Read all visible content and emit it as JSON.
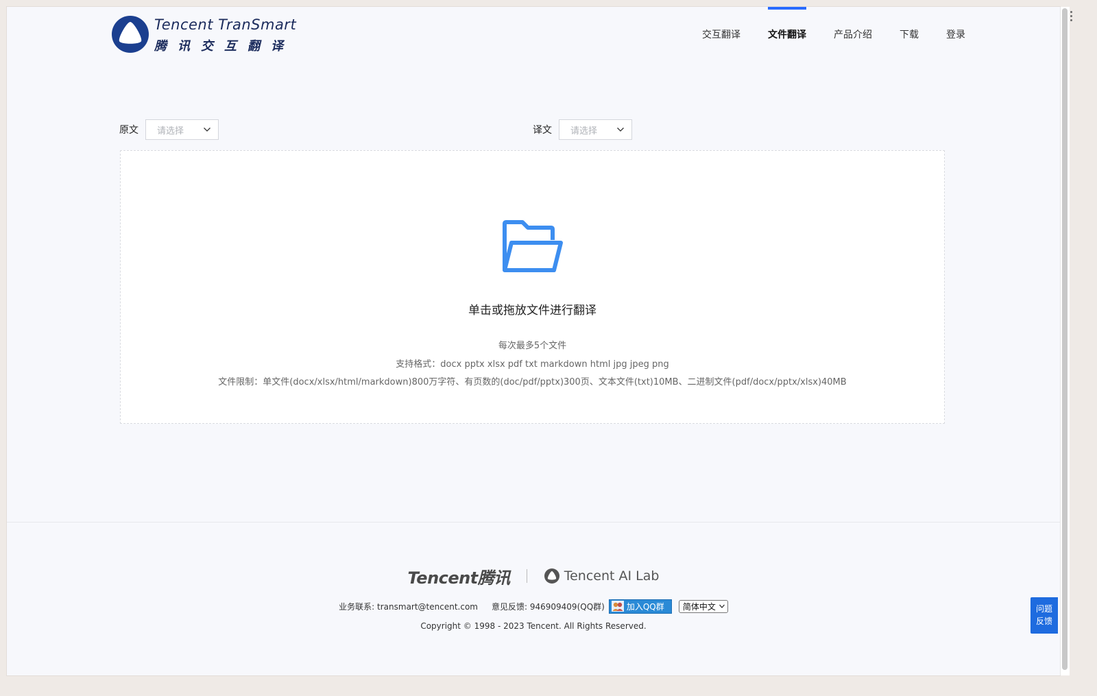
{
  "header": {
    "logo_en": "Tencent TranSmart",
    "logo_cn": "腾讯交互翻译",
    "nav": [
      {
        "label": "交互翻译",
        "active": false
      },
      {
        "label": "文件翻译",
        "active": true
      },
      {
        "label": "产品介绍",
        "active": false
      },
      {
        "label": "下载",
        "active": false
      },
      {
        "label": "登录",
        "active": false
      }
    ]
  },
  "source_lang": {
    "label": "原文",
    "placeholder": "请选择"
  },
  "target_lang": {
    "label": "译文",
    "placeholder": "请选择"
  },
  "dropzone": {
    "title": "单击或拖放文件进行翻译",
    "max_files": "每次最多5个文件",
    "formats": "支持格式：docx pptx xlsx pdf txt markdown html jpg jpeg png",
    "limits": "文件限制：单文件(docx/xlsx/html/markdown)800万字符、有页数的(doc/pdf/pptx)300页、文本文件(txt)10MB、二进制文件(pdf/docx/pptx/xlsx)40MB"
  },
  "footer": {
    "tencent_logo": "Tencent腾讯",
    "ailab": "Tencent AI Lab",
    "contact": "业务联系: transmart@tencent.com",
    "feedback_info": "意见反馈: 946909409(QQ群)",
    "qq_button": "加入QQ群",
    "language": "简体中文",
    "copyright": "Copyright © 1998 - 2023 Tencent. All Rights Reserved."
  },
  "feedback_button": {
    "line1": "问题",
    "line2": "反馈"
  },
  "colors": {
    "accent": "#2a6cff",
    "folder": "#3d8ef0",
    "logo_navy": "#1b2b5c"
  }
}
